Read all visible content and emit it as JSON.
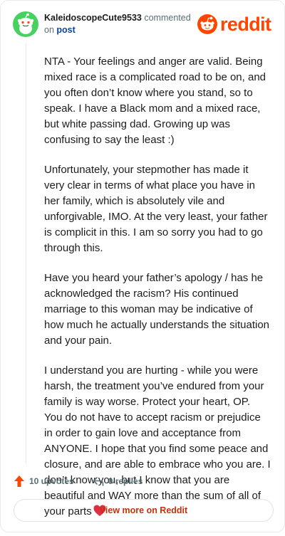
{
  "header": {
    "username": "KaleidoscopeCute9533",
    "action_text": "commented",
    "on_text": "on",
    "post_link": "post",
    "logo_text": "reddit"
  },
  "comment": {
    "paragraphs": [
      "NTA - Your feelings and anger are valid. Being mixed race is a complicated road to be on, and you often don’t know where you stand, so to speak. I have a Black mom and a mixed race, but white passing dad. Growing up was confusing to say the least :)",
      "Unfortunately, your stepmother has made it very clear in terms of what place you have in her family, which is absolutely vile and unforgivable, IMO. At the very least, your father is complicit in this. I am so sorry you had to go through this.",
      "Have you heard your father’s apology / has he acknowledged the racism? His continued marriage to this woman may be indicative of how much he actually understands the situation and your pain.",
      "I understand you are hurting - while you were harsh, the treatment you’ve endured from your family is way worse. Protect your heart, OP. You do not have to accept racism or prejudice in order to gain love and acceptance from ANYONE. I hope that you find some peace and closure, and are able to embrace who you are. I don’t know you, but I know that you are beautiful and WAY more than the sum of all of your parts"
    ]
  },
  "actions": {
    "upvotes": "10 upvotes",
    "replies": "0 replies"
  },
  "footer": {
    "view_more": "View more on Reddit"
  },
  "colors": {
    "brand": "#ff4500",
    "avatar_bg": "#46d160",
    "link": "#0a449b",
    "view_more": "#c3320b"
  },
  "icons": [
    "snoo-avatar-icon",
    "reddit-logo-icon",
    "upvote-arrow-icon",
    "reply-arrow-icon",
    "heart-emoji-icon"
  ]
}
